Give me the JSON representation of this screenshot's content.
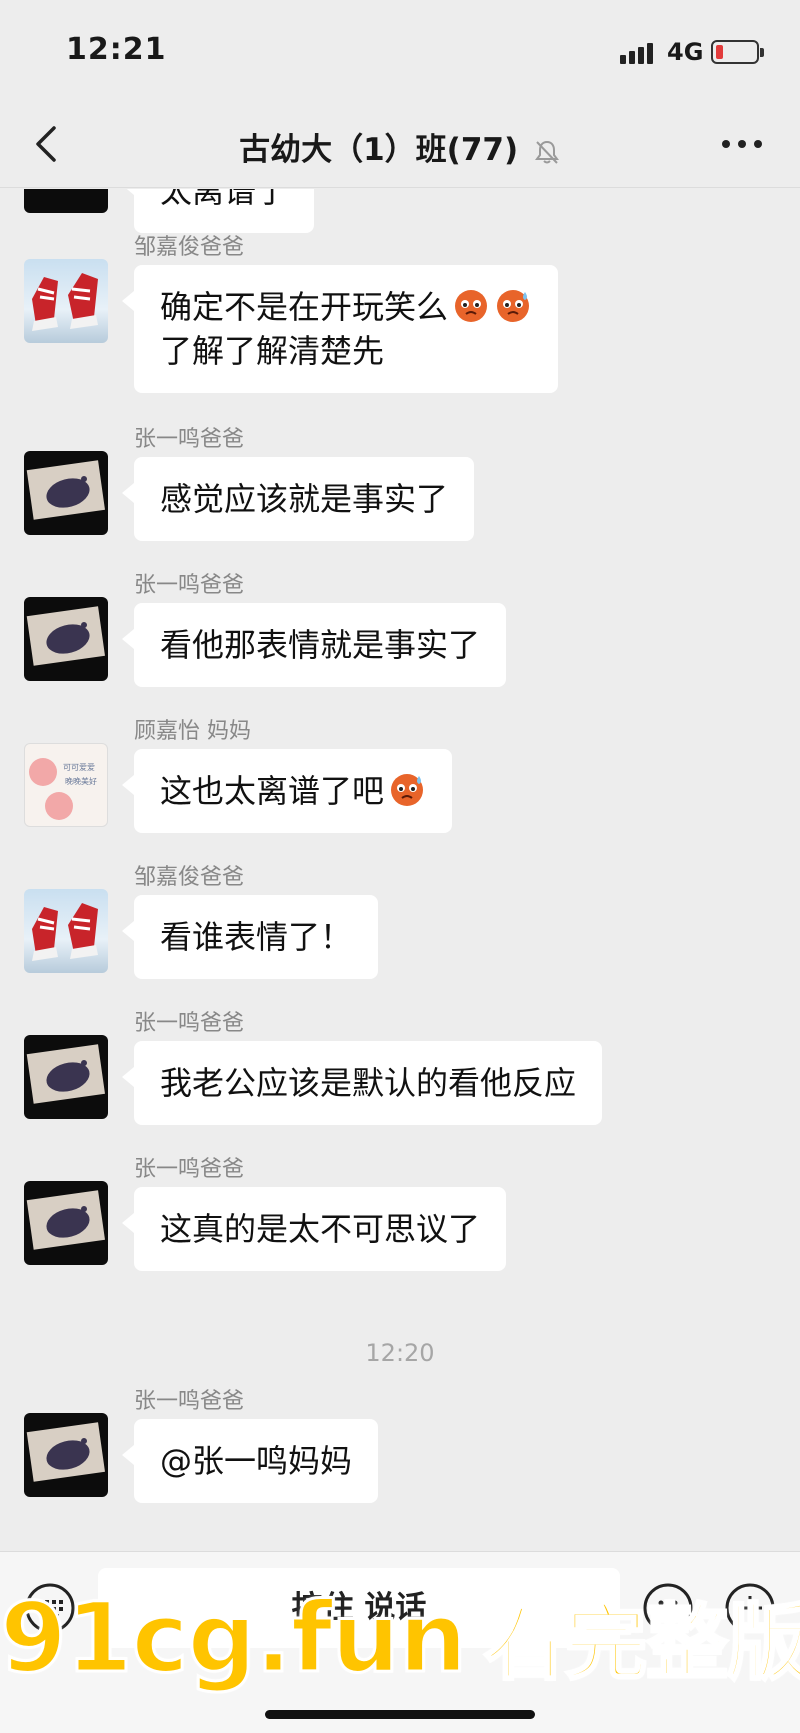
{
  "status_bar": {
    "time": "12:21",
    "network": "4G"
  },
  "nav": {
    "title": "古幼大（1）班(77)"
  },
  "messages": [
    {
      "sender": "",
      "text": "太离谱了"
    },
    {
      "sender": "邹嘉俊爸爸",
      "text": "确定不是在开玩笑么",
      "text2": "了解了解清楚先"
    },
    {
      "sender": "张一鸣爸爸",
      "text": "感觉应该就是事实了"
    },
    {
      "sender": "张一鸣爸爸",
      "text": "看他那表情就是事实了"
    },
    {
      "sender": "顾嘉怡 妈妈",
      "text": "这也太离谱了吧"
    },
    {
      "sender": "邹嘉俊爸爸",
      "text": "看谁表情了！"
    },
    {
      "sender": "张一鸣爸爸",
      "text": "我老公应该是默认的看他反应"
    },
    {
      "sender": "张一鸣爸爸",
      "text": "这真的是太不可思议了"
    },
    {
      "sender": "张一鸣爸爸",
      "text": "@张一鸣妈妈"
    }
  ],
  "timestamp": "12:20",
  "input_bar": {
    "hold_to_talk": "按住 说话"
  },
  "avatar_card_text": [
    "可可爱爱",
    "晚晚美好"
  ],
  "watermark": {
    "domain": "91cg.fun",
    "label": "看完整版"
  },
  "colors": {
    "background": "#ededed",
    "bubble": "#ffffff",
    "watermark": "#ffc400",
    "battery_low": "#e23b3b"
  }
}
